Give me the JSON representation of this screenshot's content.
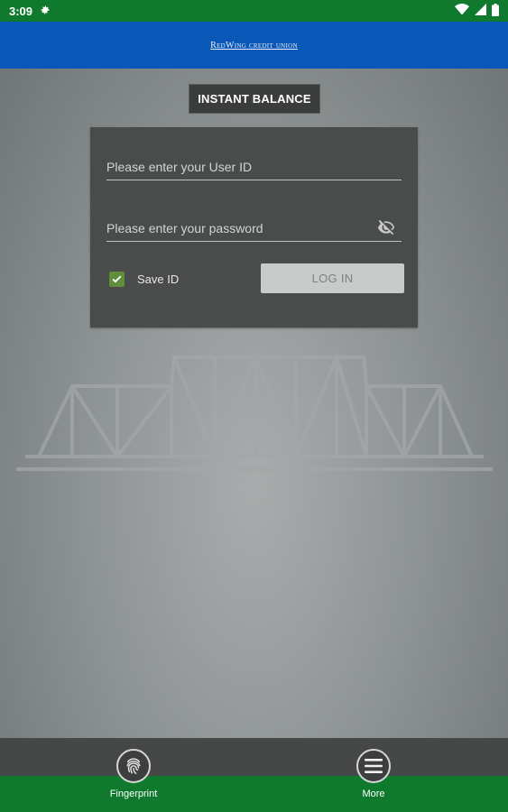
{
  "status_bar": {
    "time": "3:09"
  },
  "header": {
    "brand_first": "Red",
    "brand_second": "Wing",
    "brand_rest": "credit union"
  },
  "instant_balance_label": "INSTANT BALANCE",
  "login": {
    "user_placeholder": "Please enter your User ID",
    "password_placeholder": "Please enter your password",
    "save_id_label": "Save ID",
    "save_id_checked": true,
    "login_label": "LOG IN"
  },
  "bottom_nav": {
    "items": [
      {
        "label": "Fingerprint",
        "icon": "fingerprint-icon"
      },
      {
        "label": "More",
        "icon": "menu-icon"
      }
    ]
  },
  "colors": {
    "status_bar": "#0f7a2e",
    "header": "#0958b7",
    "card": "#4a4b4b",
    "checkbox": "#5f8f3a"
  }
}
